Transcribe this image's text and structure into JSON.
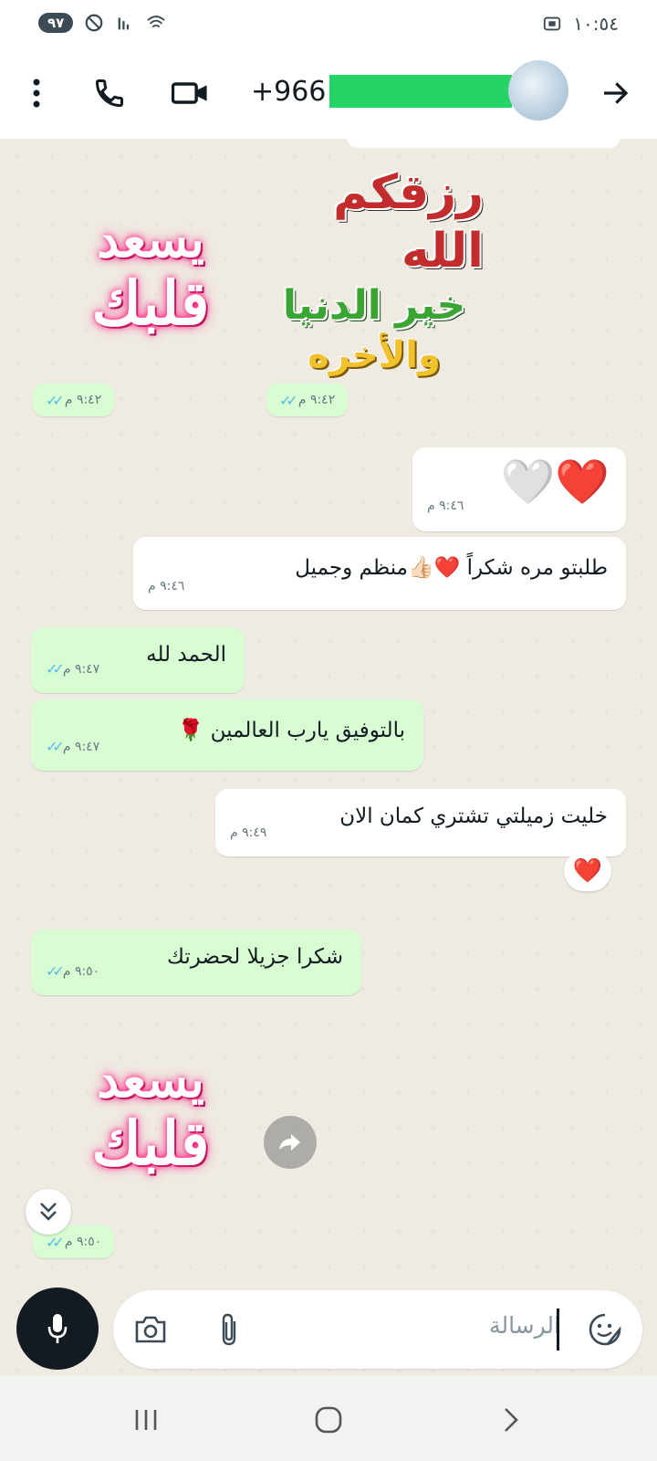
{
  "status_bar": {
    "battery": "٩٧",
    "time": "١٠:٥٤"
  },
  "header": {
    "contact_prefix": "+966",
    "contact_redacted": true
  },
  "messages": [
    {
      "type": "sticker",
      "direction": "out",
      "lines": [
        "يسعد",
        "قلبك"
      ],
      "time": "٩:٤٢ م",
      "status": "read"
    },
    {
      "type": "sticker",
      "direction": "out",
      "lines": [
        "رزقكم الله",
        "خير الدنيا",
        "والأخره"
      ],
      "time": "٩:٤٢ م",
      "status": "read"
    },
    {
      "type": "emoji",
      "direction": "in",
      "text": "❤️🤍",
      "time": "٩:٤٦ م"
    },
    {
      "type": "text",
      "direction": "in",
      "text": "طلبتو مره شكراً ❤️👍🏻منظم وجميل",
      "time": "٩:٤٦ م"
    },
    {
      "type": "text",
      "direction": "out",
      "text": "الحمد لله",
      "time": "٩:٤٧ م",
      "status": "read"
    },
    {
      "type": "text",
      "direction": "out",
      "text": "بالتوفيق يارب العالمين 🌹",
      "time": "٩:٤٧ م",
      "status": "read"
    },
    {
      "type": "text",
      "direction": "in",
      "text": "خليت زميلتي تشتري كمان الان",
      "time": "٩:٤٩ م",
      "reaction": "❤️"
    },
    {
      "type": "text",
      "direction": "out",
      "text": "شكرا جزيلا لحضرتك",
      "time": "٩:٥٠ م",
      "status": "read"
    },
    {
      "type": "sticker",
      "direction": "out",
      "lines": [
        "يسعد",
        "قلبك"
      ],
      "time": "٩:٥٠ م",
      "status": "read"
    }
  ],
  "input": {
    "placeholder": "الرسالة"
  },
  "colors": {
    "outgoing_bubble": "#d9fdd3",
    "incoming_bubble": "#ffffff",
    "read_ticks": "#53bdeb",
    "chat_background": "#efeae2"
  }
}
